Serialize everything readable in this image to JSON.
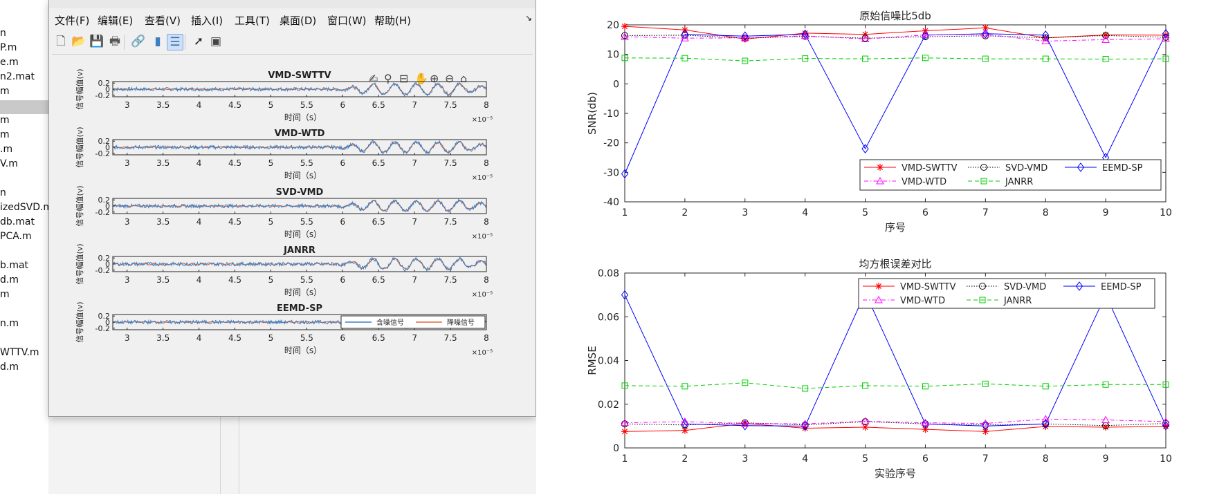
{
  "file_list": {
    "items": [
      {
        "label": "n"
      },
      {
        "label": "P.m"
      },
      {
        "label": "e.m"
      },
      {
        "label": "n2.mat"
      },
      {
        "label": "m"
      },
      {
        "label": ""
      },
      {
        "label": "m"
      },
      {
        "label": "m"
      },
      {
        "label": ".m"
      },
      {
        "label": "V.m"
      },
      {
        "label": ""
      },
      {
        "label": "n"
      },
      {
        "label": "izedSVD.m"
      },
      {
        "label": "db.mat"
      },
      {
        "label": "PCA.m"
      },
      {
        "label": ""
      },
      {
        "label": "b.mat"
      },
      {
        "label": "d.m"
      },
      {
        "label": "m"
      },
      {
        "label": ""
      },
      {
        "label": "n.m"
      },
      {
        "label": ""
      },
      {
        "label": "WTTV.m"
      },
      {
        "label": "d.m"
      }
    ]
  },
  "figure_window": {
    "menus": [
      "文件(F)",
      "编辑(E)",
      "查看(V)",
      "插入(I)",
      "工具(T)",
      "桌面(D)",
      "窗口(W)",
      "帮助(H)"
    ],
    "toolbar_icons": [
      "new-file-icon",
      "open-folder-icon",
      "save-icon",
      "print-icon",
      "link-plot-icon",
      "colorbar-icon",
      "legend-icon",
      "pointer-icon",
      "property-editor-icon"
    ],
    "axes_toolbar_icons": [
      "brush-icon",
      "data-tip-icon",
      "data-cursor-icon",
      "pan-icon",
      "zoom-in-icon",
      "zoom-out-icon",
      "home-icon"
    ],
    "legend": {
      "noisy": "含噪信号",
      "denoised": "降噪信号"
    },
    "colors": {
      "noisy": "#3b7fc4",
      "denoised": "#e0693a"
    }
  },
  "chart_data": [
    {
      "type": "line",
      "title": "VMD-SWTTV",
      "xlabel": "时间（s）",
      "ylabel": "信号幅值(v)",
      "xlim": [
        2.8,
        8
      ],
      "ylim": [
        -0.25,
        0.25
      ],
      "xticks": [
        "3",
        "3.5",
        "4",
        "4.5",
        "5",
        "5.5",
        "6",
        "6.5",
        "7",
        "7.5",
        "8"
      ],
      "yticks": [
        "0.2",
        "0",
        "-0.2"
      ],
      "x_exponent": "×10⁻⁵",
      "series": [
        {
          "name": "含噪信号"
        },
        {
          "name": "降噪信号"
        }
      ]
    },
    {
      "type": "line",
      "title": "VMD-WTD",
      "xlabel": "时间（s）",
      "ylabel": "信号幅值(v)",
      "xlim": [
        2.8,
        8
      ],
      "ylim": [
        -0.25,
        0.25
      ],
      "xticks": [
        "3",
        "3.5",
        "4",
        "4.5",
        "5",
        "5.5",
        "6",
        "6.5",
        "7",
        "7.5",
        "8"
      ],
      "yticks": [
        "0.2",
        "0",
        "-0.2"
      ],
      "x_exponent": "×10⁻⁵",
      "series": [
        {
          "name": "含噪信号"
        },
        {
          "name": "降噪信号"
        }
      ]
    },
    {
      "type": "line",
      "title": "SVD-VMD",
      "xlabel": "时间（s）",
      "ylabel": "信号幅值(v)",
      "xlim": [
        2.8,
        8
      ],
      "ylim": [
        -0.25,
        0.25
      ],
      "xticks": [
        "3",
        "3.5",
        "4",
        "4.5",
        "5",
        "5.5",
        "6",
        "6.5",
        "7",
        "7.5",
        "8"
      ],
      "yticks": [
        "0.2",
        "0",
        "-0.2"
      ],
      "x_exponent": "×10⁻⁵",
      "series": [
        {
          "name": "含噪信号"
        },
        {
          "name": "降噪信号"
        }
      ]
    },
    {
      "type": "line",
      "title": "JANRR",
      "xlabel": "时间（s）",
      "ylabel": "信号幅值(v)",
      "xlim": [
        2.8,
        8
      ],
      "ylim": [
        -0.25,
        0.25
      ],
      "xticks": [
        "3",
        "3.5",
        "4",
        "4.5",
        "5",
        "5.5",
        "6",
        "6.5",
        "7",
        "7.5",
        "8"
      ],
      "yticks": [
        "0.2",
        "0",
        "-0.2"
      ],
      "x_exponent": "×10⁻⁵",
      "series": [
        {
          "name": "含噪信号"
        },
        {
          "name": "降噪信号"
        }
      ]
    },
    {
      "type": "line",
      "title": "EEMD-SP",
      "xlabel": "时间（s）",
      "ylabel": "信号幅值(v)",
      "xlim": [
        2.8,
        8
      ],
      "ylim": [
        -0.25,
        0.25
      ],
      "xticks": [
        "3",
        "3.5",
        "4",
        "4.5",
        "5",
        "5.5",
        "6",
        "6.5",
        "7",
        "7.5",
        "8"
      ],
      "yticks": [
        "0.2",
        "0",
        "-0.2"
      ],
      "x_exponent": "×10⁻⁵",
      "legend": [
        "含噪信号",
        "降噪信号"
      ],
      "series": [
        {
          "name": "含噪信号"
        },
        {
          "name": "降噪信号"
        }
      ]
    },
    {
      "type": "line",
      "title": "原始信噪比5db",
      "xlabel": "序号",
      "ylabel": "SNR(db)",
      "x": [
        1,
        2,
        3,
        4,
        5,
        6,
        7,
        8,
        9,
        10
      ],
      "xlim": [
        1,
        10
      ],
      "ylim": [
        -40,
        20
      ],
      "yticks": [
        "20",
        "10",
        "0",
        "-10",
        "-20",
        "-30",
        "-40"
      ],
      "legend_position": "bottom-right",
      "series": [
        {
          "name": "VMD-SWTTV",
          "color": "#ff0000",
          "marker": "*",
          "style": "solid",
          "values": [
            19.5,
            18.3,
            15.2,
            17.2,
            16.8,
            18.0,
            19.0,
            15.6,
            16.6,
            16.5
          ]
        },
        {
          "name": "SVD-VMD",
          "color": "#000000",
          "marker": "o",
          "style": "dotted",
          "values": [
            16.4,
            16.5,
            15.5,
            16.1,
            15.5,
            16.0,
            16.3,
            15.6,
            16.4,
            15.8
          ]
        },
        {
          "name": "EEMD-SP",
          "color": "#0000ff",
          "marker": "diamond",
          "style": "solid",
          "values": [
            -30.5,
            16.8,
            16.2,
            16.8,
            -22.0,
            16.5,
            17.0,
            16.5,
            -25.0,
            17.0
          ]
        },
        {
          "name": "VMD-WTD",
          "color": "#ff00ff",
          "marker": "triangle",
          "style": "dashdot",
          "values": [
            16.0,
            15.5,
            15.6,
            16.3,
            15.2,
            16.6,
            16.8,
            14.5,
            15.0,
            15.3
          ]
        },
        {
          "name": "JANRR",
          "color": "#00cc00",
          "marker": "square",
          "style": "dashed",
          "values": [
            8.8,
            8.7,
            7.8,
            8.6,
            8.5,
            8.8,
            8.5,
            8.5,
            8.4,
            8.5
          ]
        }
      ]
    },
    {
      "type": "line",
      "title": "均方根误差对比",
      "xlabel": "实验序号",
      "ylabel": "RMSE",
      "x": [
        1,
        2,
        3,
        4,
        5,
        6,
        7,
        8,
        9,
        10
      ],
      "xlim": [
        1,
        10
      ],
      "ylim": [
        0,
        0.08
      ],
      "yticks": [
        "0.08",
        "0.06",
        "0.04",
        "0.02",
        "0"
      ],
      "legend_position": "top-right",
      "series": [
        {
          "name": "VMD-SWTTV",
          "color": "#ff0000",
          "marker": "*",
          "style": "solid",
          "values": [
            0.0075,
            0.008,
            0.0112,
            0.009,
            0.0095,
            0.0085,
            0.0075,
            0.0098,
            0.0095,
            0.0098
          ]
        },
        {
          "name": "SVD-VMD",
          "color": "#000000",
          "marker": "o",
          "style": "dotted",
          "values": [
            0.011,
            0.0105,
            0.0115,
            0.0105,
            0.012,
            0.011,
            0.0105,
            0.011,
            0.0102,
            0.0112
          ]
        },
        {
          "name": "EEMD-SP",
          "color": "#0000ff",
          "marker": "diamond",
          "style": "solid",
          "values": [
            0.07,
            0.011,
            0.0102,
            0.01,
            0.071,
            0.011,
            0.01,
            0.011,
            0.07,
            0.0102
          ]
        },
        {
          "name": "VMD-WTD",
          "color": "#ff00ff",
          "marker": "triangle",
          "style": "dashdot",
          "values": [
            0.0115,
            0.012,
            0.0112,
            0.011,
            0.0122,
            0.0115,
            0.0112,
            0.0132,
            0.0128,
            0.012
          ]
        },
        {
          "name": "JANRR",
          "color": "#00cc00",
          "marker": "square",
          "style": "dashed",
          "values": [
            0.0285,
            0.0282,
            0.0298,
            0.0272,
            0.0285,
            0.0282,
            0.0293,
            0.0282,
            0.029,
            0.029
          ]
        }
      ]
    }
  ]
}
